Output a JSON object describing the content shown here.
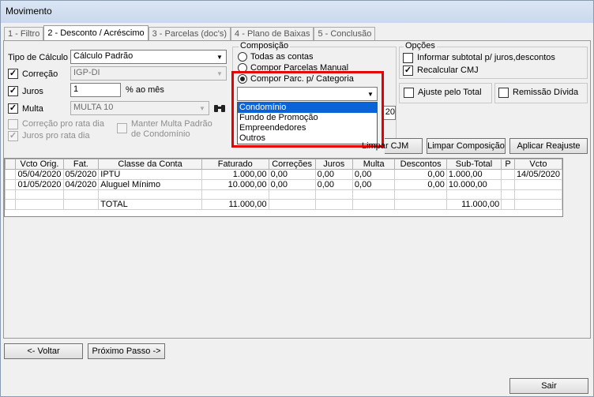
{
  "window": {
    "title": "Movimento"
  },
  "tabs": [
    {
      "label": "1 - Filtro"
    },
    {
      "label": "2 - Desconto / Acréscimo"
    },
    {
      "label": "3 - Parcelas (doc's)"
    },
    {
      "label": "4 - Plano de Baixas"
    },
    {
      "label": "5 - Conclusão"
    }
  ],
  "form": {
    "tipo_calculo_label": "Tipo de Cálculo",
    "tipo_calculo_value": "Cálculo Padrão",
    "correcao_label": "Correção",
    "correcao_value": "IGP-DI",
    "juros_label": "Juros",
    "juros_value": "1",
    "juros_unit": "% ao mês",
    "multa_label": "Multa",
    "multa_value": "MULTA 10",
    "correcao_pro_rata": "Correção pro rata dia",
    "juros_pro_rata": "Juros pro rata dia",
    "manter_multa_1": "Manter Multa Padrão",
    "manter_multa_2": "de Condomínio"
  },
  "composicao": {
    "title": "Composição",
    "options": [
      "Todas as contas",
      "Compor Parcelas Manual",
      "Compor Parc. p/ Categoria"
    ],
    "selected": 2,
    "dropdown_value": "",
    "dropdown_options": [
      "Condomínio",
      "Fundo de Promoção",
      "Empreendedores",
      "Outros"
    ],
    "hidden_field_value": "20"
  },
  "opcoes": {
    "title": "Opções",
    "informar_subtotal": "Informar subtotal p/ juros,descontos",
    "recalcular_cmj": "Recalcular CMJ",
    "ajuste_total": "Ajuste pelo Total",
    "remissao_divida": "Remissão Dívida"
  },
  "buttons": {
    "limpar_cjm": "Limpar CJM",
    "limpar_composicao": "Limpar Composição",
    "aplicar_reajuste": "Aplicar Reajuste",
    "voltar": "<- Voltar",
    "proximo": "Próximo Passo ->",
    "sair": "Sair"
  },
  "table": {
    "columns": [
      "",
      "Vcto Orig.",
      "Fat.",
      "Classe da Conta",
      "Faturado",
      "Correções",
      "Juros",
      "Multa",
      "Descontos",
      "Sub-Total",
      "P",
      "Vcto"
    ],
    "rows": [
      [
        "",
        "05/04/2020",
        "05/2020",
        "IPTU",
        "1.000,00",
        "0,00",
        "0,00",
        "0,00",
        "0,00",
        "1.000,00",
        "",
        "14/05/2020"
      ],
      [
        "",
        "01/05/2020",
        "04/2020",
        "Aluguel Mínimo",
        "10.000,00",
        "0,00",
        "0,00",
        "0,00",
        "0,00",
        "10.000,00",
        "",
        ""
      ],
      [
        "",
        "",
        "",
        "",
        "",
        "",
        "",
        "",
        "",
        "",
        "",
        ""
      ],
      [
        "",
        "",
        "",
        "TOTAL",
        "11.000,00",
        "",
        "",
        "",
        "",
        "11.000,00",
        "",
        ""
      ]
    ]
  }
}
